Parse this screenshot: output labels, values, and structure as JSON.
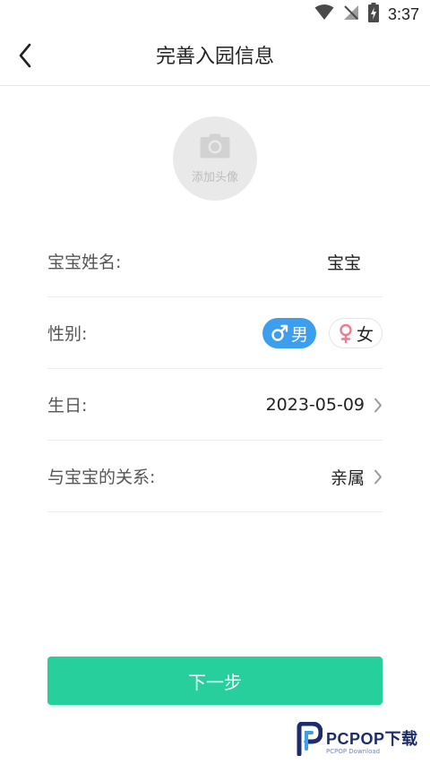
{
  "status_bar": {
    "time": "3:37",
    "icons": [
      "wifi-icon",
      "no-signal-icon",
      "battery-charging-icon"
    ]
  },
  "app_bar": {
    "title": "完善入园信息",
    "back_icon": "chevron-left-icon"
  },
  "avatar": {
    "label": "添加头像",
    "icon": "camera-icon"
  },
  "form": {
    "name": {
      "label": "宝宝姓名:",
      "value": "宝宝"
    },
    "gender": {
      "label": "性别:",
      "male_label": "男",
      "female_label": "女",
      "selected": "男"
    },
    "birthday": {
      "label": "生日:",
      "value": "2023-05-09"
    },
    "relation": {
      "label": "与宝宝的关系:",
      "value": "亲属"
    }
  },
  "next_button": {
    "label": "下一步"
  },
  "watermark": {
    "main": "PCPOP下载",
    "sub": "PCPOP Download"
  },
  "colors": {
    "primary_button": "#27cf9c",
    "male_selected": "#3d9ef0",
    "female_symbol": "#f07a8f",
    "watermark": "#1c2d6b"
  }
}
